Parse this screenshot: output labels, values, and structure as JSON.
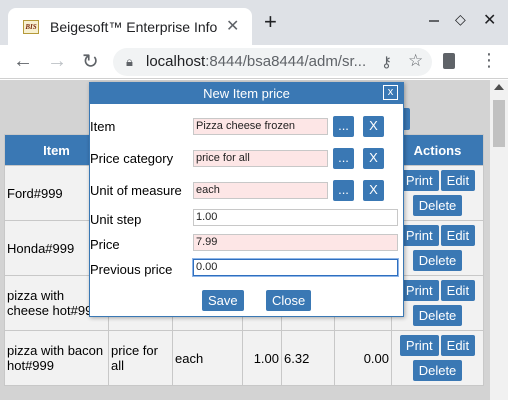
{
  "browser": {
    "tab_title": "Beigesoft™ Enterprise Information",
    "favicon_text": "BIS",
    "url_host": "localhost",
    "url_rest": ":8444/bsa8444/adm/sr..."
  },
  "table": {
    "headers": [
      "Item",
      "",
      "",
      "",
      "",
      "",
      "Actions"
    ],
    "rows": [
      {
        "item": "Ford#999",
        "category": "",
        "uom": "",
        "step": "",
        "price": "",
        "prev": ""
      },
      {
        "item": "Honda#999",
        "category": "",
        "uom": "",
        "step": "",
        "price": "",
        "prev": ""
      },
      {
        "item": "pizza with cheese hot#999",
        "category": "",
        "uom": "",
        "step": "",
        "price": "",
        "prev": ""
      },
      {
        "item": "pizza with bacon hot#999",
        "category": "price for all",
        "uom": "each",
        "step": "1.00",
        "price": "6.32",
        "prev": "0.00"
      }
    ],
    "print_label": "Print",
    "edit_label": "Edit",
    "delete_label": "Delete"
  },
  "dialog": {
    "title": "New Item price",
    "close_label": "x",
    "fields": {
      "item": {
        "label": "Item",
        "value": "Pizza cheese frozen"
      },
      "category": {
        "label": "Price category",
        "value": "price for all"
      },
      "uom": {
        "label": "Unit of measure",
        "value": "each"
      },
      "step": {
        "label": "Unit step",
        "value": "1.00"
      },
      "price": {
        "label": "Price",
        "value": "7.99"
      },
      "prev": {
        "label": "Previous price",
        "value": "0.00"
      }
    },
    "picker_label": "...",
    "clear_label": "X",
    "save_label": "Save",
    "cancel_label": "Close"
  }
}
